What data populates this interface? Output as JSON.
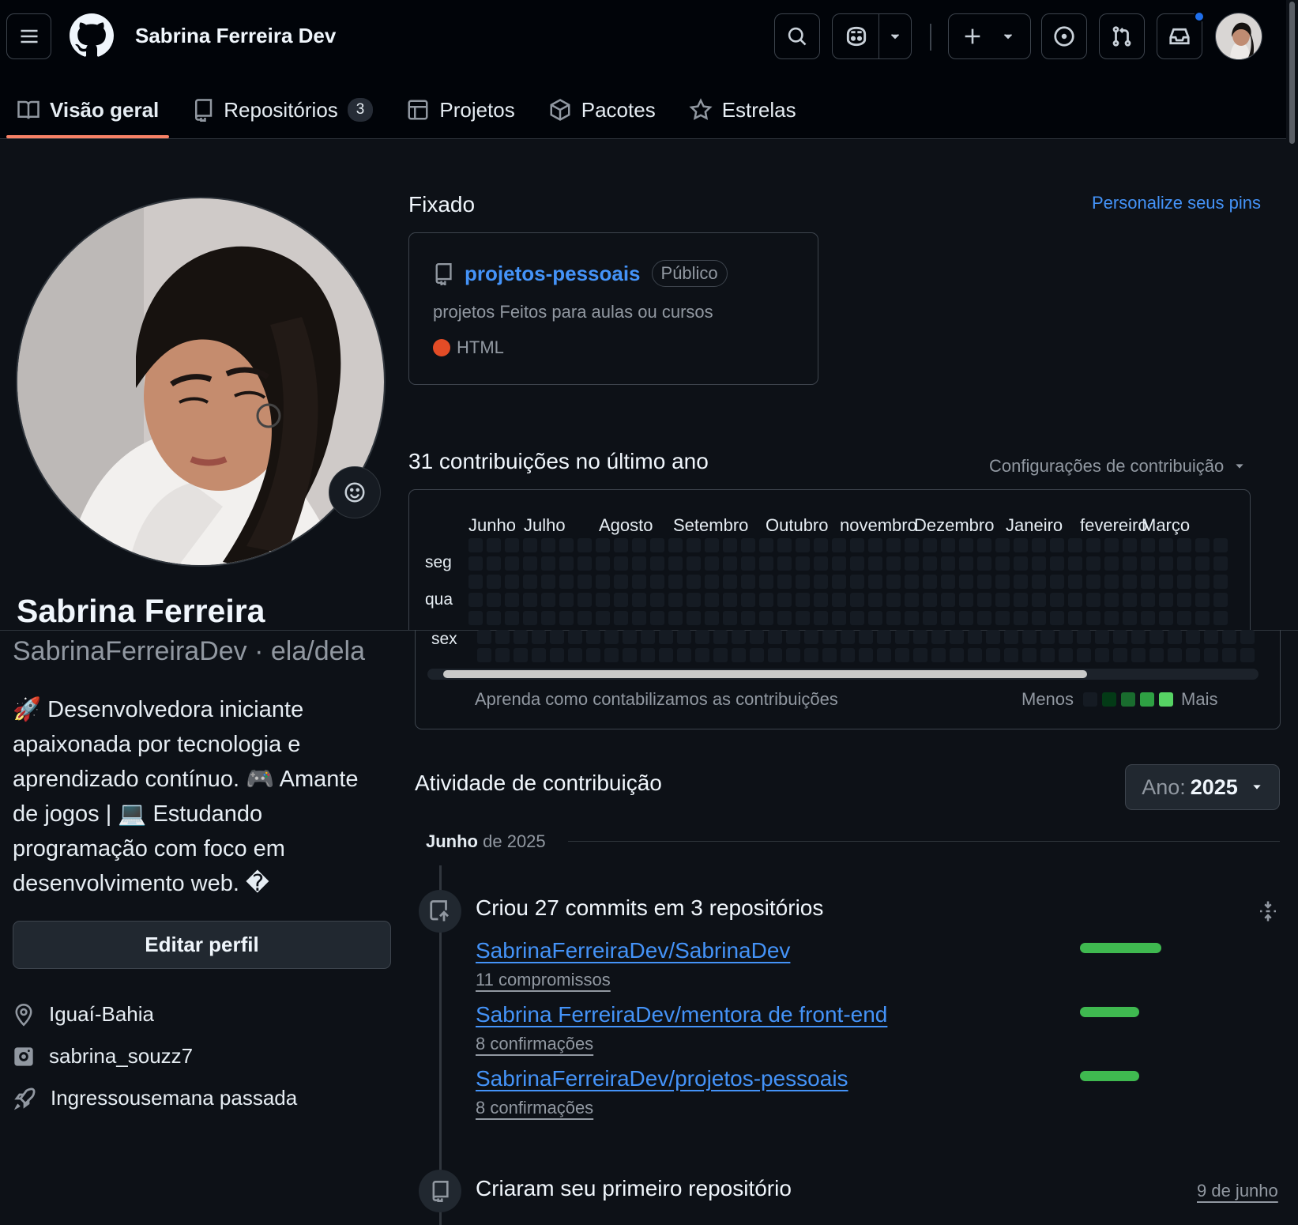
{
  "header": {
    "title": "Sabrina Ferreira Dev",
    "icons": [
      "menu-icon",
      "github-logo",
      "search-icon",
      "copilot-icon",
      "chevron-down-icon",
      "plus-icon",
      "issues-icon",
      "pull-requests-icon",
      "inbox-icon",
      "avatar"
    ]
  },
  "tabs": [
    {
      "label": "Visão geral",
      "icon": "book-icon",
      "active": true
    },
    {
      "label": "Repositórios",
      "icon": "repo-icon",
      "count": "3"
    },
    {
      "label": "Projetos",
      "icon": "table-icon"
    },
    {
      "label": "Pacotes",
      "icon": "package-icon"
    },
    {
      "label": "Estrelas",
      "icon": "star-icon"
    }
  ],
  "profile": {
    "name": "Sabrina Ferreira",
    "login_line": "SabrinaFerreiraDev · ela/dela",
    "bio": "🚀 Desenvolvedora iniciante apaixonada por tecnologia e aprendizado contínuo. 🎮 Amante de jogos | 💻 Estudando programação com foco em desenvolvimento web. �",
    "edit_label": "Editar perfil",
    "location": "Iguaí-Bahia",
    "instagram": "sabrina_souzz7",
    "joined": "Ingressousemana passada"
  },
  "pinned": {
    "heading": "Fixado",
    "customize": "Personalize seus pins",
    "repo": {
      "name": "projetos-pessoais",
      "visibility": "Público",
      "description": "projetos Feitos para aulas ou cursos",
      "language": "HTML",
      "language_color": "#e34c26"
    }
  },
  "contributions": {
    "heading": "31 contribuições no último ano",
    "settings": "Configurações de contribuição",
    "months": [
      "Junho",
      "Julho",
      "Agosto",
      "Setembro",
      "Outubro",
      "novembro",
      "Dezembro",
      "Janeiro",
      "fevereiro",
      "Março"
    ],
    "days": [
      "seg",
      "qua",
      "sex"
    ],
    "learn": "Aprenda como contabilizamos as contribuições",
    "less": "Menos",
    "more": "Mais",
    "legend_colors": [
      "#151b23",
      "#033a16",
      "#196c2e",
      "#2ea043",
      "#56d364"
    ]
  },
  "activity": {
    "heading": "Atividade de contribuição",
    "year_label": "Ano:",
    "year": "2025",
    "period_month": "Junho",
    "period_rest": "de 2025",
    "commits_title": "Criou 27 commits em 3 repositórios",
    "repos": [
      {
        "name": "SabrinaFerreiraDev/SabrinaDev",
        "sub": "11 compromissos",
        "share": 1.0
      },
      {
        "name": "Sabrina FerreiraDev/mentora de front-end",
        "sub": "8 confirmações",
        "share": 0.73
      },
      {
        "name": "SabrinaFerreiraDev/projetos-pessoais",
        "sub": "8 confirmações",
        "share": 0.73
      }
    ],
    "first_repo_title": "Criaram seu primeiro repositório",
    "first_repo_date": "9 de junho"
  }
}
